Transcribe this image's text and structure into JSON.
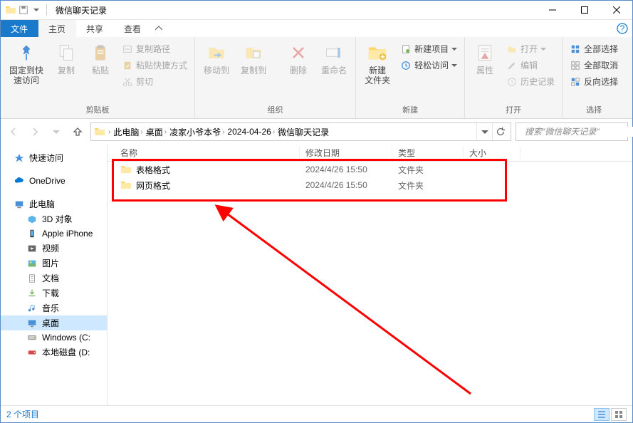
{
  "window": {
    "title": "微信聊天记录"
  },
  "tabs": {
    "file": "文件",
    "home": "主页",
    "share": "共享",
    "view": "查看"
  },
  "ribbon": {
    "clipboard": {
      "pin": "固定到快\n速访问",
      "copy": "复制",
      "paste": "粘贴",
      "copy_path": "复制路径",
      "paste_shortcut": "粘贴快捷方式",
      "cut": "剪切",
      "group": "剪贴板"
    },
    "organize": {
      "move_to": "移动到",
      "copy_to": "复制到",
      "delete": "删除",
      "rename": "重命名",
      "group": "组织"
    },
    "new": {
      "new_folder": "新建\n文件夹",
      "new_item": "新建项目",
      "easy_access": "轻松访问",
      "group": "新建"
    },
    "open": {
      "properties": "属性",
      "open": "打开",
      "edit": "编辑",
      "history": "历史记录",
      "group": "打开"
    },
    "select": {
      "select_all": "全部选择",
      "select_none": "全部取消",
      "invert": "反向选择",
      "group": "选择"
    }
  },
  "breadcrumbs": [
    "此电脑",
    "桌面",
    "凌家小爷本爷",
    "2024-04-26",
    "微信聊天记录"
  ],
  "search": {
    "placeholder": "搜索\"微信聊天记录\""
  },
  "nav": {
    "quick_access": "快速访问",
    "onedrive": "OneDrive",
    "this_pc": "此电脑",
    "items": [
      "3D 对象",
      "Apple iPhone",
      "视频",
      "图片",
      "文档",
      "下载",
      "音乐",
      "桌面",
      "Windows (C:",
      "本地磁盘 (D:"
    ]
  },
  "columns": {
    "name": "名称",
    "date": "修改日期",
    "type": "类型",
    "size": "大小"
  },
  "files": [
    {
      "name": "表格格式",
      "date": "2024/4/26 15:50",
      "type": "文件夹"
    },
    {
      "name": "网页格式",
      "date": "2024/4/26 15:50",
      "type": "文件夹"
    }
  ],
  "status": {
    "count": "2 个项目"
  }
}
